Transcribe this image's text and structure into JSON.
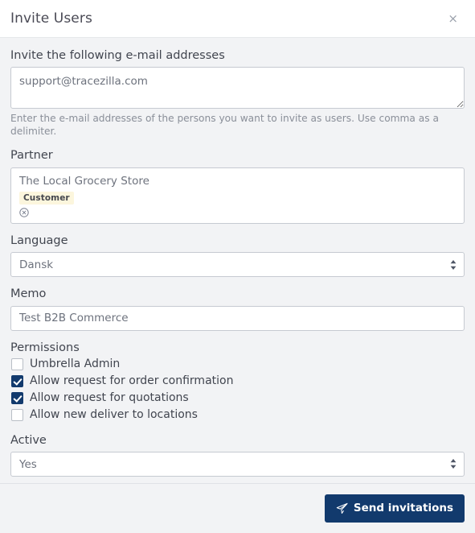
{
  "header": {
    "title": "Invite Users",
    "close_label": "×"
  },
  "form": {
    "emails": {
      "label": "Invite the following e-mail addresses",
      "value": "support@tracezilla.com",
      "placeholder": "",
      "help": "Enter the e-mail addresses of the persons you want to invite as users. Use comma as a delimiter."
    },
    "partner": {
      "label": "Partner",
      "name": "The Local Grocery Store",
      "badge": "Customer",
      "remove_icon": "circle-x-icon"
    },
    "language": {
      "label": "Language",
      "value": "Dansk",
      "options": [
        "Dansk"
      ]
    },
    "memo": {
      "label": "Memo",
      "value": "Test B2B Commerce",
      "placeholder": ""
    },
    "permissions": {
      "label": "Permissions",
      "items": [
        {
          "label": "Umbrella Admin",
          "checked": false
        },
        {
          "label": "Allow request for order confirmation",
          "checked": true
        },
        {
          "label": "Allow request for quotations",
          "checked": true
        },
        {
          "label": "Allow new deliver to locations",
          "checked": false
        }
      ]
    },
    "active": {
      "label": "Active",
      "value": "Yes",
      "options": [
        "Yes"
      ]
    }
  },
  "footer": {
    "submit_label": "Send invitations",
    "submit_icon": "paper-plane-icon"
  },
  "colors": {
    "accent": "#123a6d",
    "badge_bg": "#fcf6dd",
    "body_bg": "#f2f3f5",
    "header_bg": "#ffffff",
    "border": "#c6cad1"
  }
}
